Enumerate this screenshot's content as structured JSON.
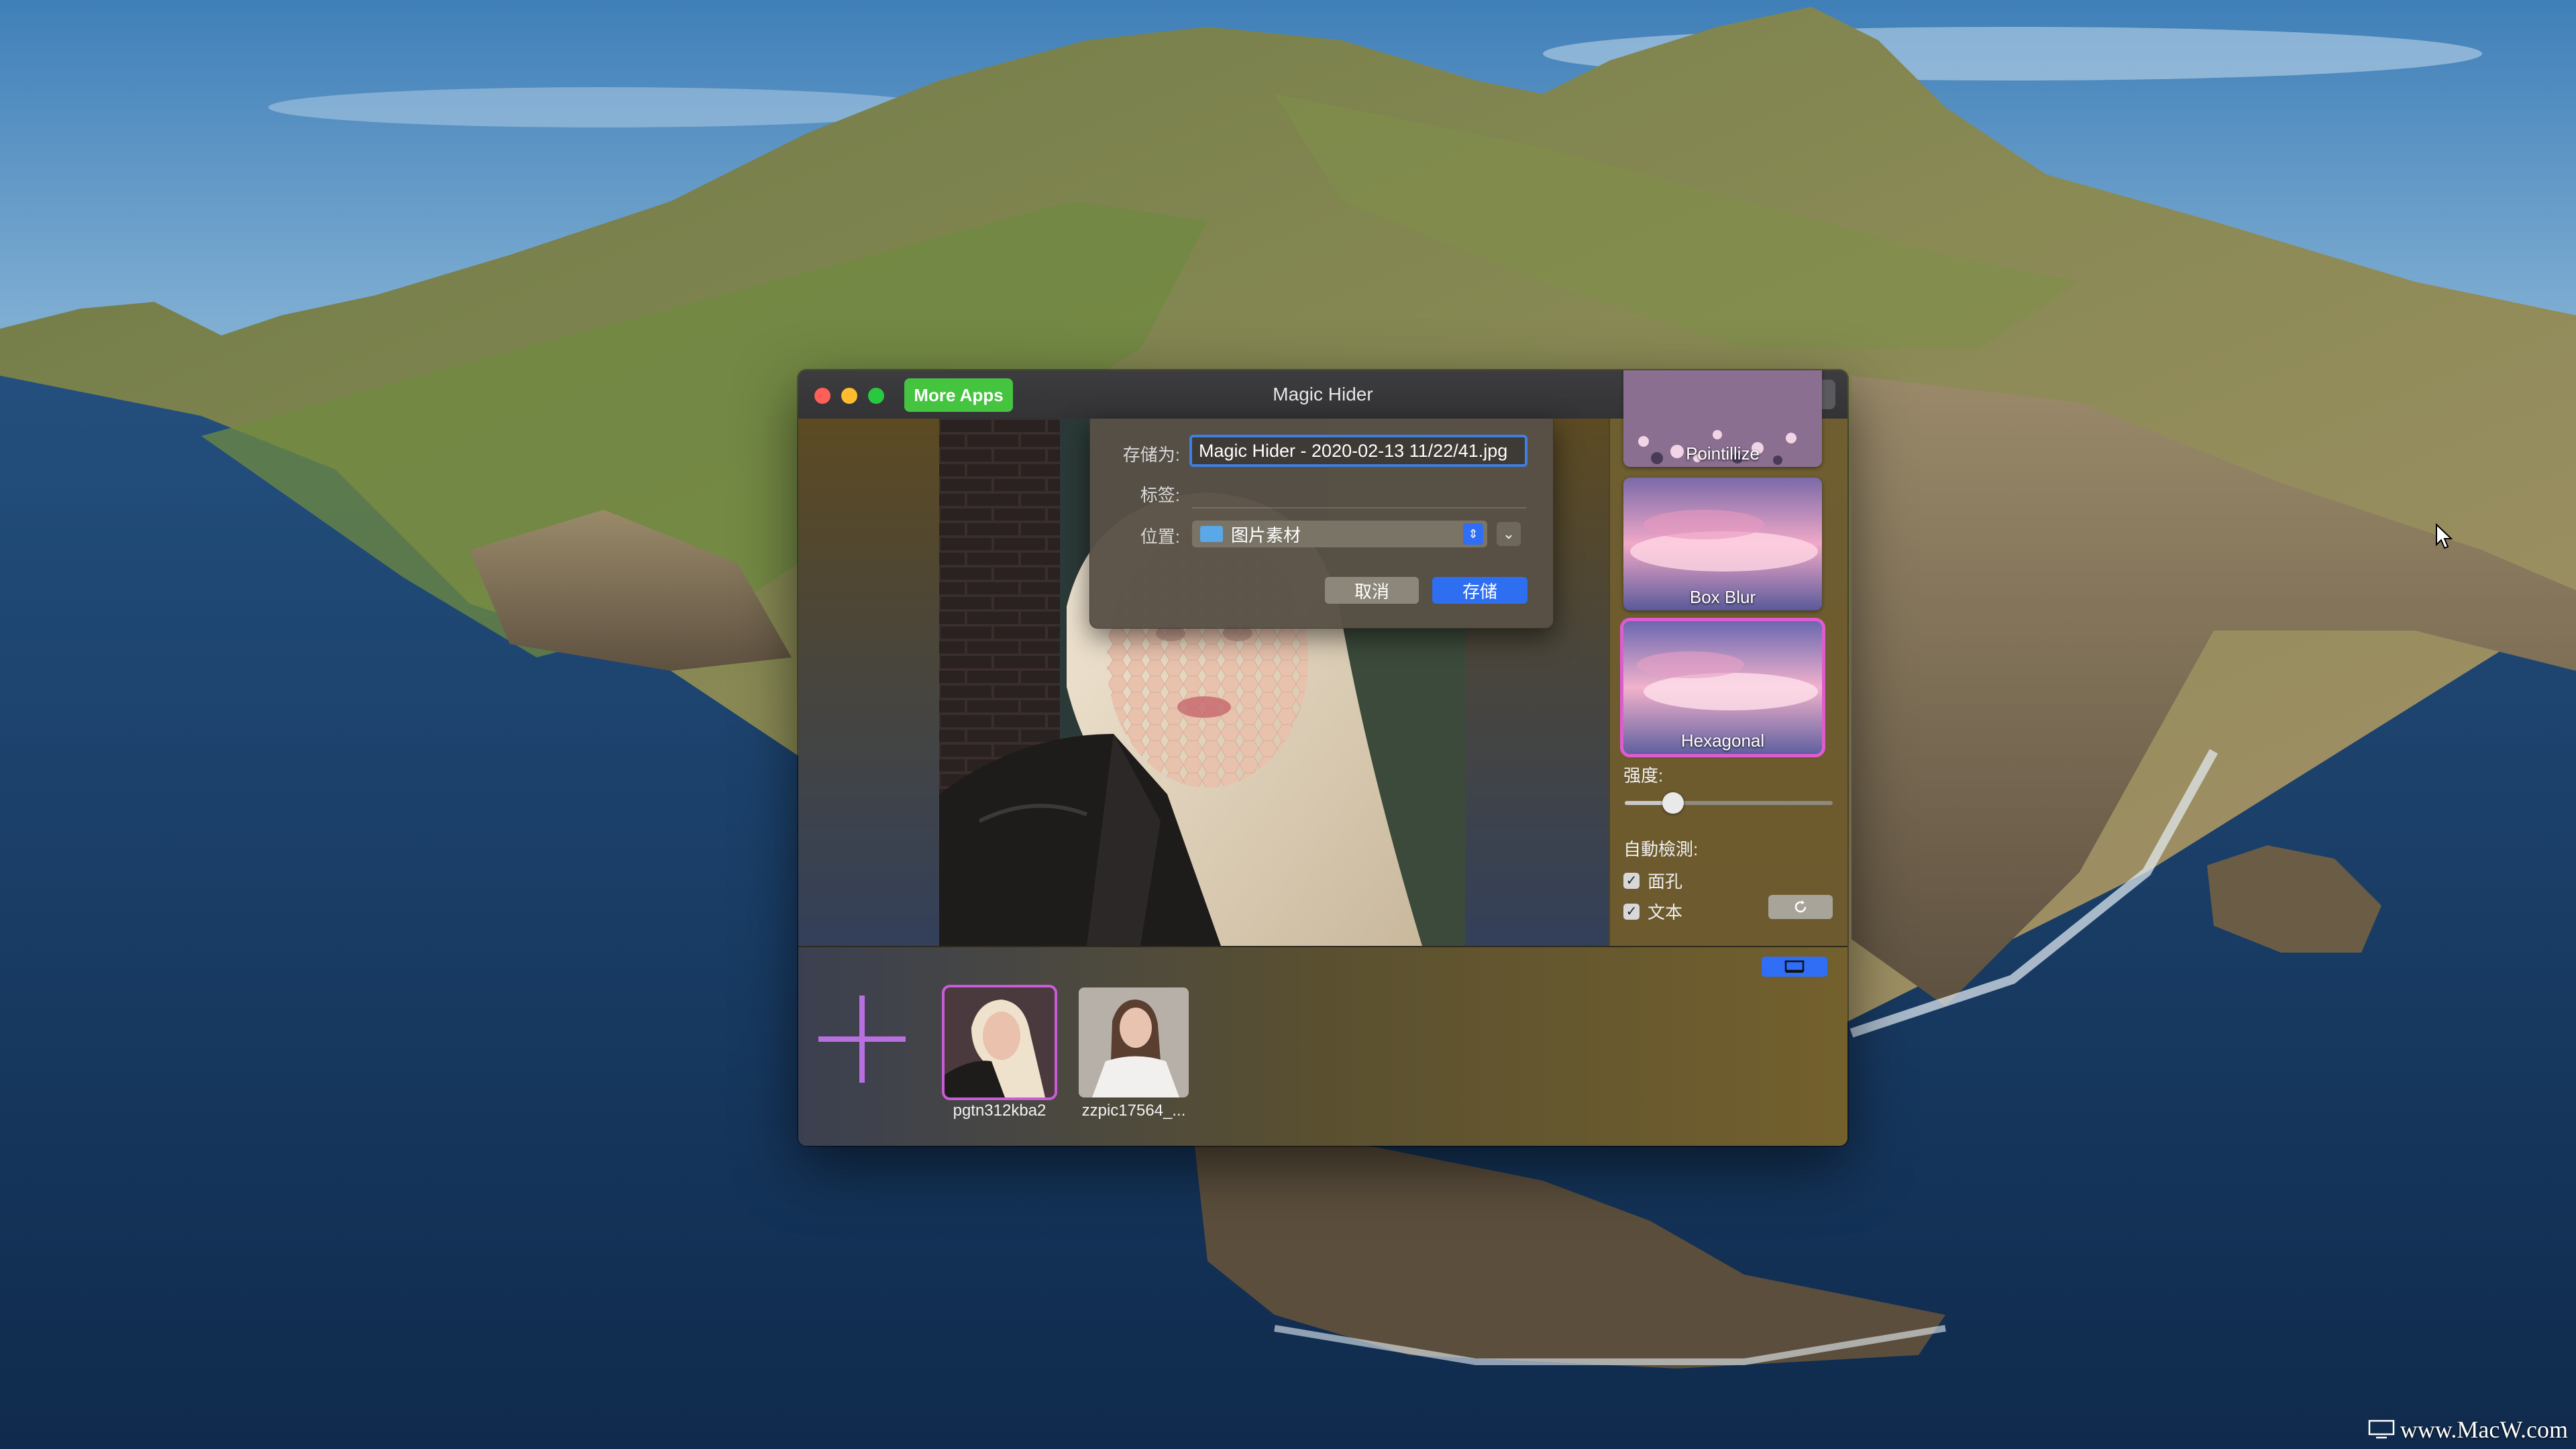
{
  "window": {
    "title": "Magic Hider",
    "more_apps_label": "More Apps"
  },
  "toolbar": {
    "icons": [
      "wand-icon",
      "share-icon",
      "gear-icon"
    ]
  },
  "save_sheet": {
    "save_as_label": "存储为:",
    "filename": "Magic Hider - 2020-02-13 11/22/41.jpg",
    "tags_label": "标签:",
    "location_label": "位置:",
    "location_value": "图片素材",
    "cancel_label": "取消",
    "save_label": "存储"
  },
  "filters": [
    {
      "name": "Pointillize",
      "selected": false
    },
    {
      "name": "Box Blur",
      "selected": false
    },
    {
      "name": "Hexagonal",
      "selected": true
    }
  ],
  "intensity": {
    "label": "强度:",
    "value": 0.2
  },
  "auto_detect": {
    "label": "自動檢測:",
    "face_label": "面孔",
    "face_checked": true,
    "text_label": "文本",
    "text_checked": true
  },
  "thumbnails": [
    {
      "label": "pgtn312kba2",
      "active": true
    },
    {
      "label": "zzpic17564_...",
      "active": false
    }
  ],
  "watermark": "www.MacW.com",
  "colors": {
    "accent_blue": "#2e6ff2",
    "more_apps_green": "#45c43f",
    "selection_pink": "#e05bd0"
  }
}
